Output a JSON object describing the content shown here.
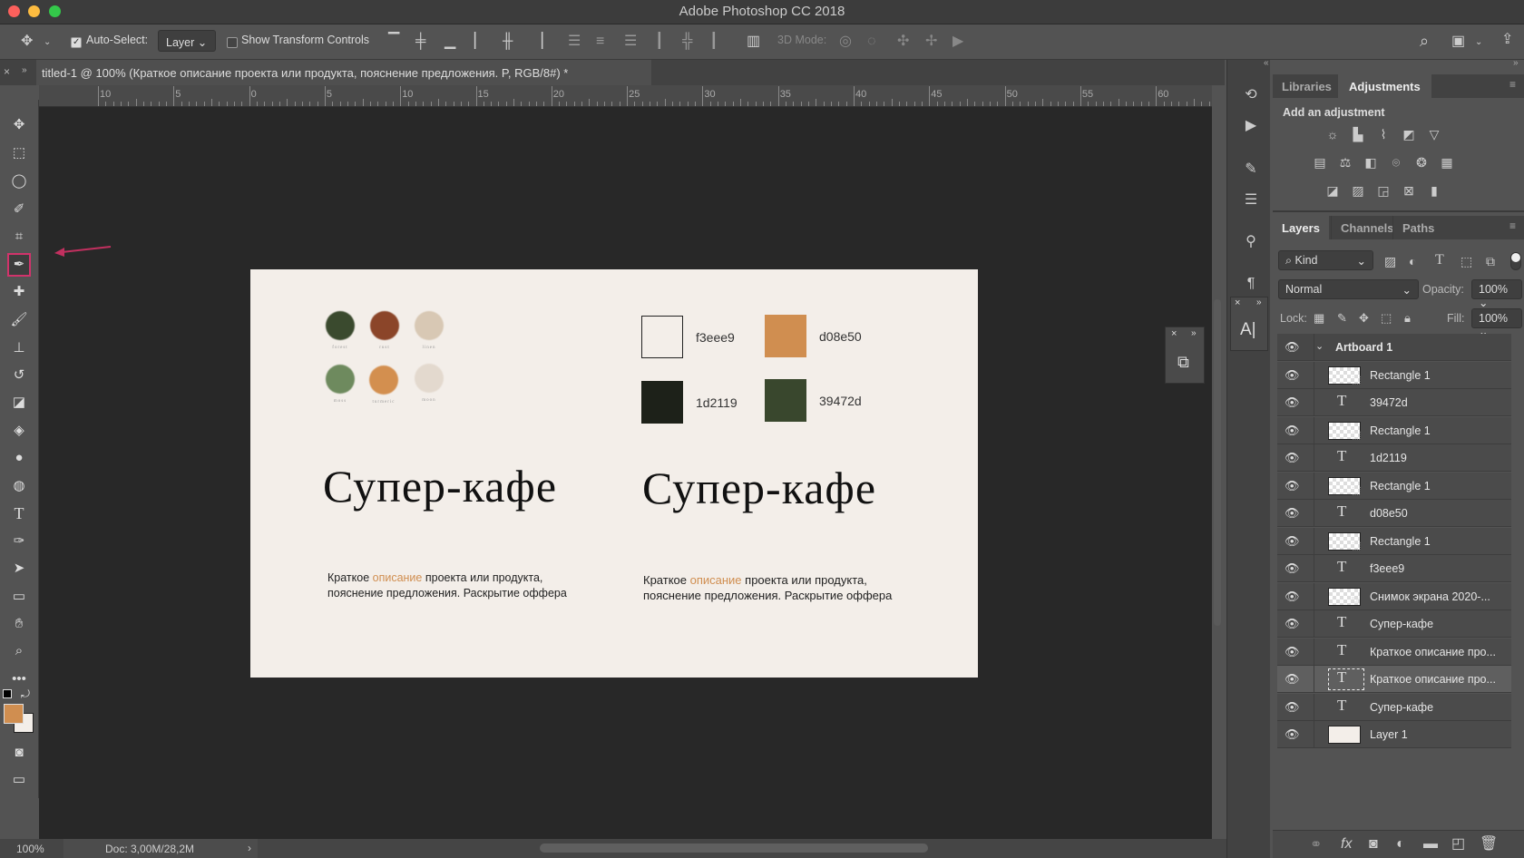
{
  "window": {
    "title": "Adobe Photoshop CC 2018"
  },
  "options": {
    "auto_select_label": "Auto-Select:",
    "auto_select_checked": true,
    "auto_select_target": "Layer",
    "show_transform_label": "Show Transform Controls",
    "show_transform_checked": false,
    "mode_3d_label": "3D Mode:"
  },
  "document": {
    "tab_title": "titled-1 @ 100% (Краткое описание проекта или продукта, пояснение предложения. P, RGB/8#) *",
    "zoom": "100%",
    "doc_size": "Doc: 3,00M/28,2M"
  },
  "ruler": {
    "labels": [
      "10",
      "5",
      "0",
      "5",
      "10",
      "15",
      "20",
      "25",
      "30",
      "35",
      "40",
      "45",
      "50",
      "55",
      "60"
    ]
  },
  "tools": [
    "move",
    "rectangular-marquee",
    "lasso",
    "quick-selection",
    "crop",
    "eyedropper",
    "healing-brush",
    "brush",
    "clone-stamp",
    "history-brush",
    "eraser",
    "paint-bucket",
    "blur",
    "dodge",
    "type",
    "pen",
    "path-selection",
    "rectangle",
    "hand",
    "zoom",
    "more"
  ],
  "selected_tool": "eyedropper",
  "colors": {
    "foreground": "#d08e50",
    "background": "#f3eee9",
    "highlight": "#d1336b"
  },
  "artboard": {
    "circles": [
      {
        "label": "forest",
        "color": "#3a4a2e"
      },
      {
        "label": "rust",
        "color": "#8b4529"
      },
      {
        "label": "linen",
        "color": "#d8c8b4"
      },
      {
        "label": "moss",
        "color": "#6e8a5e"
      },
      {
        "label": "turmeric",
        "color": "#d38f4f"
      },
      {
        "label": "moon",
        "color": "#e3d9ce"
      }
    ],
    "swatches": [
      {
        "hex": "f3eee9",
        "color": "#f3eee9"
      },
      {
        "hex": "d08e50",
        "color": "#d08e50"
      },
      {
        "hex": "1d2119",
        "color": "#1d2119"
      },
      {
        "hex": "39472d",
        "color": "#39472d"
      }
    ],
    "title": "Супер-кафе",
    "para_start": "Краткое ",
    "para_highlight": "описание",
    "para_end": " проекта или продукта,",
    "para_line2": "пояснение предложения. Раскрытие оффера"
  },
  "panels": {
    "top_tabs": [
      "Libraries",
      "Adjustments"
    ],
    "active_top_tab": "Adjustments",
    "add_adjustment": "Add an adjustment",
    "layer_tabs": [
      "Layers",
      "Channels",
      "Paths"
    ],
    "filter_kind": "Kind",
    "blend_mode": "Normal",
    "opacity_label": "Opacity:",
    "opacity": "100%",
    "lock_label": "Lock:",
    "fill_label": "Fill:",
    "fill": "100%"
  },
  "layers": [
    {
      "name": "Artboard 1",
      "type": "artboard"
    },
    {
      "name": "Rectangle 1",
      "type": "shape"
    },
    {
      "name": "39472d",
      "type": "text"
    },
    {
      "name": "Rectangle 1",
      "type": "shape"
    },
    {
      "name": "1d2119",
      "type": "text"
    },
    {
      "name": "Rectangle 1",
      "type": "shape"
    },
    {
      "name": "d08e50",
      "type": "text"
    },
    {
      "name": "Rectangle 1",
      "type": "shape"
    },
    {
      "name": "f3eee9",
      "type": "text"
    },
    {
      "name": "Снимок экрана 2020-...",
      "type": "smart"
    },
    {
      "name": "Супер-кафе",
      "type": "text"
    },
    {
      "name": "Краткое описание про...",
      "type": "text"
    },
    {
      "name": "Краткое описание про...",
      "type": "text",
      "selected": true
    },
    {
      "name": "Супер-кафе",
      "type": "text"
    },
    {
      "name": "Layer 1",
      "type": "fill"
    }
  ]
}
